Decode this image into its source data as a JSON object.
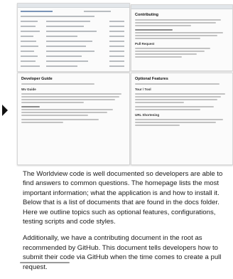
{
  "panels": {
    "p1": {},
    "p2": {
      "title": "Contributing",
      "subtitle": "Pull Request"
    },
    "p3": {
      "title": "Developer Guide",
      "subtitle": "Wv Guide"
    },
    "p4": {
      "title": "Optional Features",
      "subtitle": "Tour / Tool",
      "subtitle2": "URL Shortening"
    }
  },
  "article": {
    "paragraph1": "The Worldview code is well documented so developers are able to find answers to common questions. The homepage lists the most important information; what the application is and how to install it. Below that is a list of documents that are found in the docs folder. Here we outline topics such as optional features, configurations, testing scripts and code styles.",
    "paragraph2": "Additionally, we have a contributing document in the root as recommended by GitHub. This document tells developers how to submit their code via GitHub when the time comes to create a pull request."
  },
  "icons": {
    "arrow": "chevron-right-icon"
  },
  "colors": {
    "text": "#1a1a1a",
    "panel_border": "#d8d8d8",
    "link_blue": "#7a95b8"
  }
}
